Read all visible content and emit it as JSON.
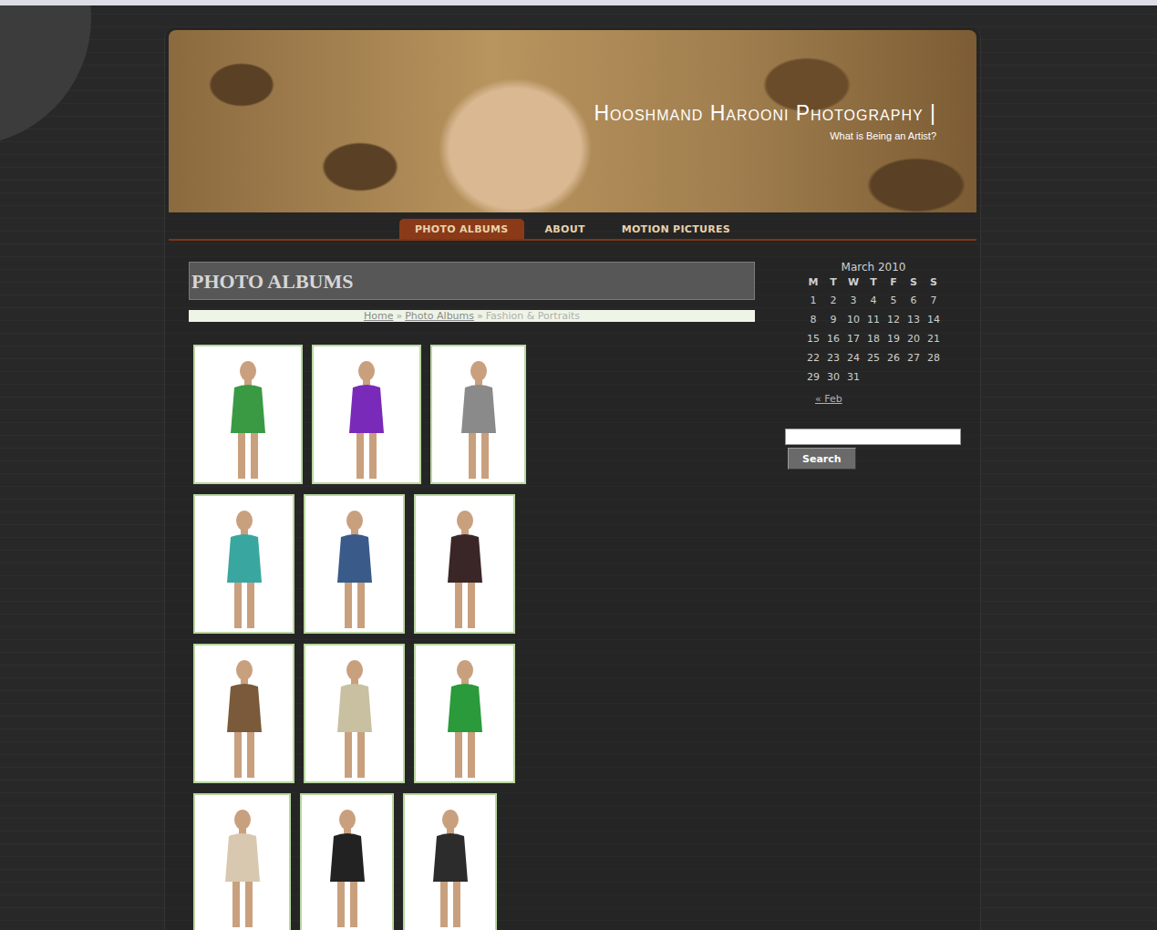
{
  "site": {
    "title": "Hooshmand Harooni Photography |",
    "tagline": "What is Being an Artist?"
  },
  "nav": [
    {
      "label": "PHOTO ALBUMS",
      "selected": true
    },
    {
      "label": "ABOUT",
      "selected": false
    },
    {
      "label": "MOTION PICTURES",
      "selected": false
    }
  ],
  "page": {
    "heading": "PHOTO ALBUMS"
  },
  "breadcrumb": {
    "separator": "»",
    "items": [
      {
        "label": "Home",
        "current": false
      },
      {
        "label": "Photo Albums",
        "current": false
      },
      {
        "label": "Fashion & Portraits",
        "current": true
      }
    ]
  },
  "gallery": {
    "rows": [
      [
        {
          "color": "#3a9a44"
        },
        {
          "color": "#7a2ab8"
        },
        {
          "color": "#8a8a8a"
        }
      ],
      [
        {
          "color": "#3aa6a0"
        },
        {
          "color": "#3a5a8a"
        },
        {
          "color": "#3a2626"
        }
      ],
      [
        {
          "color": "#7a5a3a"
        },
        {
          "color": "#c8c0a0"
        },
        {
          "color": "#2a9a3a"
        }
      ],
      [
        {
          "color": "#d8c8b0"
        },
        {
          "color": "#222222"
        },
        {
          "color": "#2c2c2c"
        }
      ]
    ]
  },
  "calendar": {
    "caption": "March 2010",
    "days": [
      "M",
      "T",
      "W",
      "T",
      "F",
      "S",
      "S"
    ],
    "weeks": [
      [
        "1",
        "2",
        "3",
        "4",
        "5",
        "6",
        "7"
      ],
      [
        "8",
        "9",
        "10",
        "11",
        "12",
        "13",
        "14"
      ],
      [
        "15",
        "16",
        "17",
        "18",
        "19",
        "20",
        "21"
      ],
      [
        "22",
        "23",
        "24",
        "25",
        "26",
        "27",
        "28"
      ],
      [
        "29",
        "30",
        "31"
      ]
    ],
    "prev": "« Feb"
  },
  "search": {
    "value": "",
    "button": "Search"
  }
}
